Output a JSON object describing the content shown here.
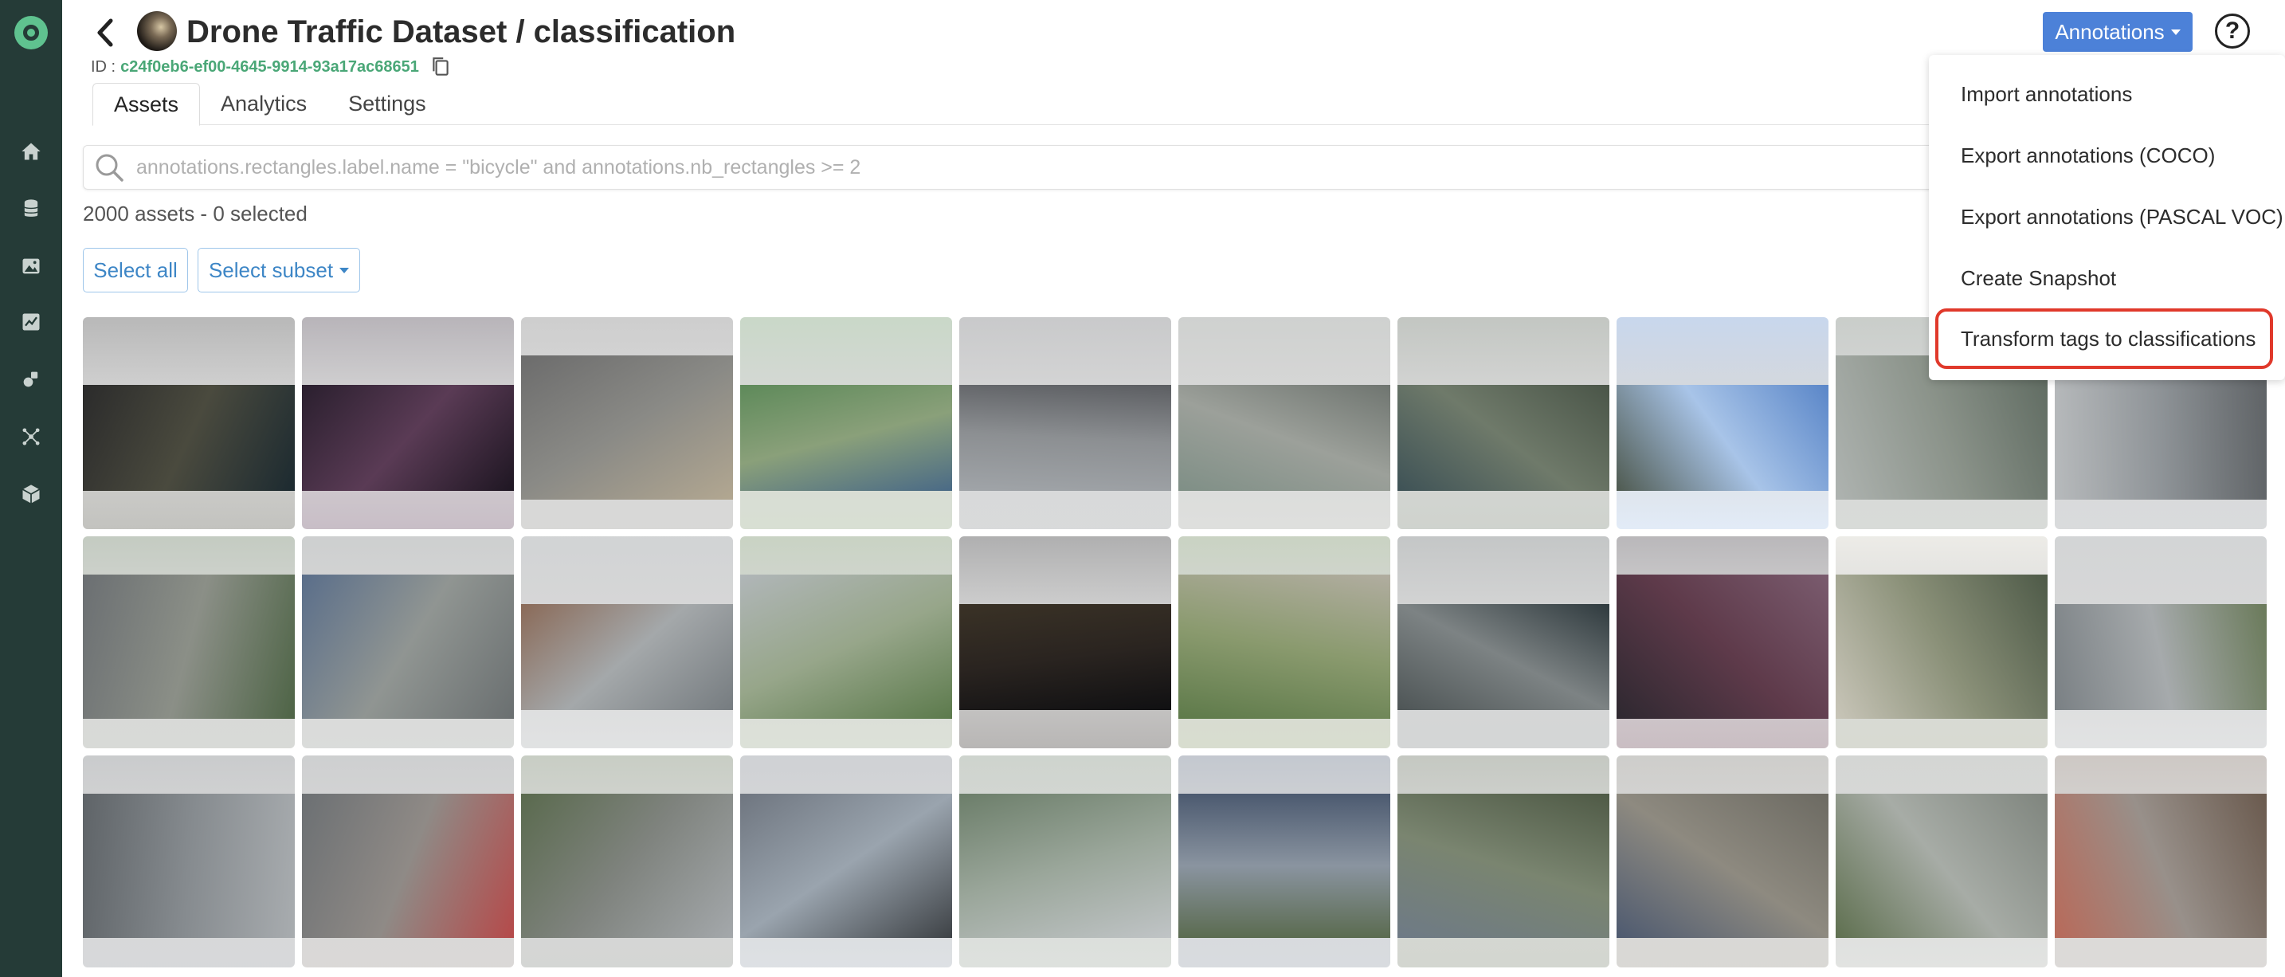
{
  "header": {
    "title": "Drone Traffic Dataset / classification",
    "id_label": "ID :",
    "id_value": "c24f0eb6-ef00-4645-9914-93a17ac68651",
    "annotations_button": "Annotations",
    "help_label": "?"
  },
  "sidebar": {
    "items": [
      "home-icon",
      "database-icon",
      "image-icon",
      "chart-icon",
      "experiment-icon",
      "network-icon",
      "box-icon"
    ]
  },
  "tabs": [
    {
      "label": "Assets",
      "active": true
    },
    {
      "label": "Analytics",
      "active": false
    },
    {
      "label": "Settings",
      "active": false
    }
  ],
  "search": {
    "placeholder": "annotations.rectangles.label.name = \"bicycle\" and annotations.nb_rectangles >= 2",
    "value": ""
  },
  "counter": "2000 assets - 0 selected",
  "selection": {
    "select_all": "Select all",
    "select_subset": "Select subset"
  },
  "dropdown": {
    "items": [
      "Import annotations",
      "Export annotations (COCO)",
      "Export annotations (PASCAL VOC)",
      "Create Snapshot",
      "Transform tags to classifications"
    ],
    "highlighted_index": 4
  },
  "colors": {
    "sidebar": "#253b37",
    "brand": "#5fc28f",
    "primary": "#4c81d8",
    "link": "#3d86c6",
    "id_text": "#4aa777",
    "highlight": "#e0392b"
  },
  "assets": {
    "count_visible": 30,
    "columns": 10,
    "rows": 3
  }
}
